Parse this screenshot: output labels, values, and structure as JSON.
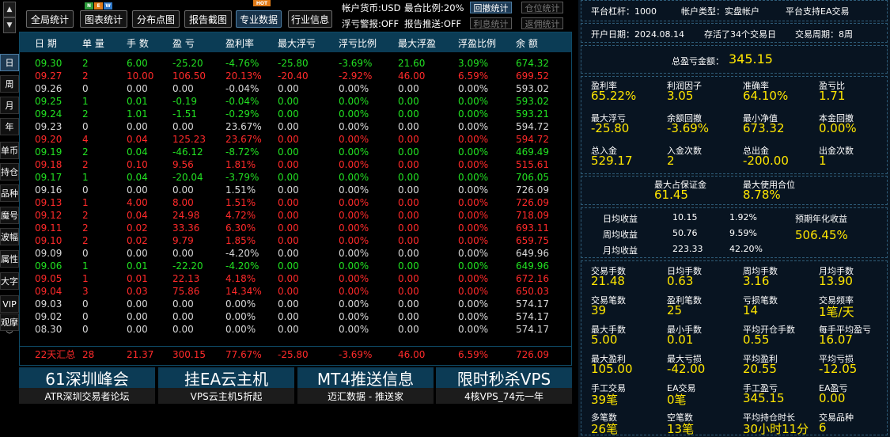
{
  "sidebar": {
    "buttons": [
      "日",
      "周",
      "月",
      "年",
      "单币",
      "持仓",
      "品种",
      "魔号",
      "波幅",
      "属性",
      "大字",
      "VIP",
      "观摩"
    ]
  },
  "toolbar": {
    "buttons": [
      "全局统计",
      "图表统计",
      "分布点图",
      "报告截图",
      "专业数据",
      "行业信息"
    ],
    "new_badge": [
      "N",
      "E",
      "W"
    ],
    "hot_badge": "HOT",
    "currency": "帐户货币:USD",
    "max_ratio": "最合比例:20%",
    "float_warn": "浮亏警报:OFF",
    "report_push": "报告推送:OFF",
    "small_buttons": [
      "回撤统计",
      "仓位统计",
      "利息统计",
      "返佣统计"
    ]
  },
  "table": {
    "headers": [
      "日 期",
      "单 量",
      "手 数",
      "盈 亏",
      "盈利率",
      "最大浮亏",
      "浮亏比例",
      "最大浮盈",
      "浮盈比例",
      "余 额"
    ],
    "rows": [
      {
        "c": "g",
        "v": [
          "09.30",
          "2",
          "6.00",
          "-25.20",
          "-4.76%",
          "-25.80",
          "-3.69%",
          "21.60",
          "3.09%",
          "674.32"
        ]
      },
      {
        "c": "r",
        "v": [
          "09.27",
          "2",
          "10.00",
          "106.50",
          "20.13%",
          "-20.40",
          "-2.92%",
          "46.00",
          "6.59%",
          "699.52"
        ]
      },
      {
        "c": "w",
        "v": [
          "09.26",
          "0",
          "0.00",
          "0.00",
          "-0.04%",
          "0.00",
          "0.00%",
          "0.00",
          "0.00%",
          "593.02"
        ]
      },
      {
        "c": "g",
        "v": [
          "09.25",
          "1",
          "0.01",
          "-0.19",
          "-0.04%",
          "0.00",
          "0.00%",
          "0.00",
          "0.00%",
          "593.02"
        ]
      },
      {
        "c": "g",
        "v": [
          "09.24",
          "2",
          "1.01",
          "-1.51",
          "-0.29%",
          "0.00",
          "0.00%",
          "0.00",
          "0.00%",
          "593.21"
        ]
      },
      {
        "c": "w",
        "v": [
          "09.23",
          "0",
          "0.00",
          "0.00",
          "23.67%",
          "0.00",
          "0.00%",
          "0.00",
          "0.00%",
          "594.72"
        ]
      },
      {
        "c": "r",
        "v": [
          "09.20",
          "4",
          "0.04",
          "125.23",
          "23.67%",
          "0.00",
          "0.00%",
          "0.00",
          "0.00%",
          "594.72"
        ]
      },
      {
        "c": "g",
        "v": [
          "09.19",
          "2",
          "0.04",
          "-46.12",
          "-8.72%",
          "0.00",
          "0.00%",
          "0.00",
          "0.00%",
          "469.49"
        ]
      },
      {
        "c": "r",
        "v": [
          "09.18",
          "2",
          "0.10",
          "9.56",
          "1.81%",
          "0.00",
          "0.00%",
          "0.00",
          "0.00%",
          "515.61"
        ]
      },
      {
        "c": "g",
        "v": [
          "09.17",
          "1",
          "0.04",
          "-20.04",
          "-3.79%",
          "0.00",
          "0.00%",
          "0.00",
          "0.00%",
          "706.05"
        ]
      },
      {
        "c": "w",
        "v": [
          "09.16",
          "0",
          "0.00",
          "0.00",
          "1.51%",
          "0.00",
          "0.00%",
          "0.00",
          "0.00%",
          "726.09"
        ]
      },
      {
        "c": "r",
        "v": [
          "09.13",
          "1",
          "4.00",
          "8.00",
          "1.51%",
          "0.00",
          "0.00%",
          "0.00",
          "0.00%",
          "726.09"
        ]
      },
      {
        "c": "r",
        "v": [
          "09.12",
          "2",
          "0.04",
          "24.98",
          "4.72%",
          "0.00",
          "0.00%",
          "0.00",
          "0.00%",
          "718.09"
        ]
      },
      {
        "c": "r",
        "v": [
          "09.11",
          "2",
          "0.02",
          "33.36",
          "6.30%",
          "0.00",
          "0.00%",
          "0.00",
          "0.00%",
          "693.11"
        ]
      },
      {
        "c": "r",
        "v": [
          "09.10",
          "2",
          "0.02",
          "9.79",
          "1.85%",
          "0.00",
          "0.00%",
          "0.00",
          "0.00%",
          "659.75"
        ]
      },
      {
        "c": "w",
        "v": [
          "09.09",
          "0",
          "0.00",
          "0.00",
          "-4.20%",
          "0.00",
          "0.00%",
          "0.00",
          "0.00%",
          "649.96"
        ]
      },
      {
        "c": "g",
        "v": [
          "09.06",
          "1",
          "0.01",
          "-22.20",
          "-4.20%",
          "0.00",
          "0.00%",
          "0.00",
          "0.00%",
          "649.96"
        ]
      },
      {
        "c": "r",
        "v": [
          "09.05",
          "1",
          "0.01",
          "22.13",
          "4.18%",
          "0.00",
          "0.00%",
          "0.00",
          "0.00%",
          "672.16"
        ]
      },
      {
        "c": "r",
        "v": [
          "09.04",
          "3",
          "0.03",
          "75.86",
          "14.34%",
          "0.00",
          "0.00%",
          "0.00",
          "0.00%",
          "650.03"
        ]
      },
      {
        "c": "w",
        "v": [
          "09.03",
          "0",
          "0.00",
          "0.00",
          "0.00%",
          "0.00",
          "0.00%",
          "0.00",
          "0.00%",
          "574.17"
        ]
      },
      {
        "c": "w",
        "v": [
          "09.02",
          "0",
          "0.00",
          "0.00",
          "0.00%",
          "0.00",
          "0.00%",
          "0.00",
          "0.00%",
          "574.17"
        ]
      },
      {
        "c": "w",
        "v": [
          "08.30",
          "0",
          "0.00",
          "0.00",
          "0.00%",
          "0.00",
          "0.00%",
          "0.00",
          "0.00%",
          "574.17"
        ]
      }
    ],
    "summary": [
      "22天汇总",
      "28",
      "21.37",
      "300.15",
      "77.67%",
      "-25.80",
      "-3.69%",
      "46.00",
      "6.59%",
      "726.09"
    ]
  },
  "ads": [
    {
      "title": "61深圳峰会",
      "sub": "ATR深圳交易者论坛"
    },
    {
      "title": "挂EA云主机",
      "sub": "VPS云主机5折起"
    },
    {
      "title": "MT4推送信息",
      "sub": "迈汇数据 - 推送家"
    },
    {
      "title": "限时秒杀VPS",
      "sub": "4核VPS_74元一年"
    }
  ],
  "right": {
    "leverage": "平台杠杆：1000",
    "account_type": "帐户类型：实盘帐户",
    "ea_support": "平台支持EA交易",
    "open_date": "开户日期：2024.08.14",
    "survived": "存活了34个交易日",
    "trade_period": "交易周期：8周",
    "total_pl_label": "总盈亏金额：",
    "total_pl": "345.15",
    "grid1": [
      [
        "盈利率",
        "65.22%"
      ],
      [
        "利润因子",
        "3.05"
      ],
      [
        "准确率",
        "64.10%"
      ],
      [
        "盈亏比",
        "1.71"
      ],
      [
        "最大浮亏",
        "-25.80"
      ],
      [
        "余额回撤",
        "-3.69%"
      ],
      [
        "最小净值",
        "673.32"
      ],
      [
        "本金回撤",
        "0.00%"
      ],
      [
        "总入金",
        "529.17"
      ],
      [
        "入金次数",
        "2"
      ],
      [
        "总出金",
        "-200.00"
      ],
      [
        "出金次数",
        "1"
      ]
    ],
    "margin": [
      [
        "最大占保证金",
        "61.45"
      ],
      [
        "最大使用合位",
        "8.78%"
      ]
    ],
    "income": [
      [
        "日均收益",
        "10.15",
        "1.92%"
      ],
      [
        "周均收益",
        "50.76",
        "9.59%"
      ],
      [
        "月均收益",
        "223.33",
        "42.20%"
      ]
    ],
    "annual_label": "预期年化收益",
    "annual": "506.45%",
    "grid2": [
      [
        "交易手数",
        "21.48"
      ],
      [
        "日均手数",
        "0.63"
      ],
      [
        "周均手数",
        "3.16"
      ],
      [
        "月均手数",
        "13.90"
      ],
      [
        "交易笔数",
        "39"
      ],
      [
        "盈利笔数",
        "25"
      ],
      [
        "亏损笔数",
        "14"
      ],
      [
        "交易频率",
        "1笔/天"
      ],
      [
        "最大手数",
        "5.00"
      ],
      [
        "最小手数",
        "0.01"
      ],
      [
        "平均开仓手数",
        "0.55"
      ],
      [
        "每手平均盈亏",
        "16.07"
      ],
      [
        "最大盈利",
        "105.00"
      ],
      [
        "最大亏损",
        "-42.00"
      ],
      [
        "平均盈利",
        "20.55"
      ],
      [
        "平均亏损",
        "-12.05"
      ],
      [
        "手工交易",
        "39笔"
      ],
      [
        "EA交易",
        "0笔"
      ],
      [
        "手工盈亏",
        "345.15"
      ],
      [
        "EA盈亏",
        "0.00"
      ],
      [
        "多笔数",
        "26笔"
      ],
      [
        "空笔数",
        "13笔"
      ],
      [
        "平均持仓时长",
        "30小时11分"
      ],
      [
        "交易品种",
        "6"
      ]
    ]
  }
}
